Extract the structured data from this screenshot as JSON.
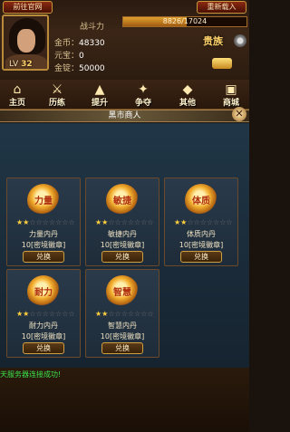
{
  "header": {
    "official_site_label": "前往官网",
    "reload_label": "重新载入",
    "power_label": "战斗力",
    "exp_text": "8826/17024",
    "exp_progress": 0.518,
    "level_prefix": "LV",
    "level": "32",
    "stats": [
      {
        "key": "金币：",
        "value": "48330"
      },
      {
        "key": "元宝：",
        "value": "0"
      },
      {
        "key": "金锭：",
        "value": "50000"
      }
    ],
    "vip_label": "贵族"
  },
  "nav": {
    "items": [
      {
        "label": "主页",
        "icon": "home-icon"
      },
      {
        "label": "历练",
        "icon": "training-icon"
      },
      {
        "label": "提升",
        "icon": "upgrade-icon"
      },
      {
        "label": "争夺",
        "icon": "battle-icon"
      },
      {
        "label": "其他",
        "icon": "other-icon"
      },
      {
        "label": "商城",
        "icon": "shop-icon"
      }
    ]
  },
  "title": "黑市商人",
  "cards": [
    {
      "orb_text": "力量",
      "name": "力量内丹",
      "cost": "10[密境徽章]",
      "stars": 2,
      "button": "兑换"
    },
    {
      "orb_text": "敏捷",
      "name": "敏捷内丹",
      "cost": "10[密境徽章]",
      "stars": 2,
      "button": "兑换"
    },
    {
      "orb_text": "体质",
      "name": "体质内丹",
      "cost": "10[密境徽章]",
      "stars": 2,
      "button": "兑换"
    },
    {
      "orb_text": "耐力",
      "name": "耐力内丹",
      "cost": "10[密境徽章]",
      "stars": 2,
      "button": "兑换"
    },
    {
      "orb_text": "智慧",
      "name": "智慧内丹",
      "cost": "10[密境徽章]",
      "stars": 2,
      "button": "兑换"
    }
  ],
  "status_message": "天服务器连接成功!",
  "colors": {
    "status_text": "#3ae04a",
    "star_on": "#ffd040",
    "button_border": "#d0a040"
  }
}
